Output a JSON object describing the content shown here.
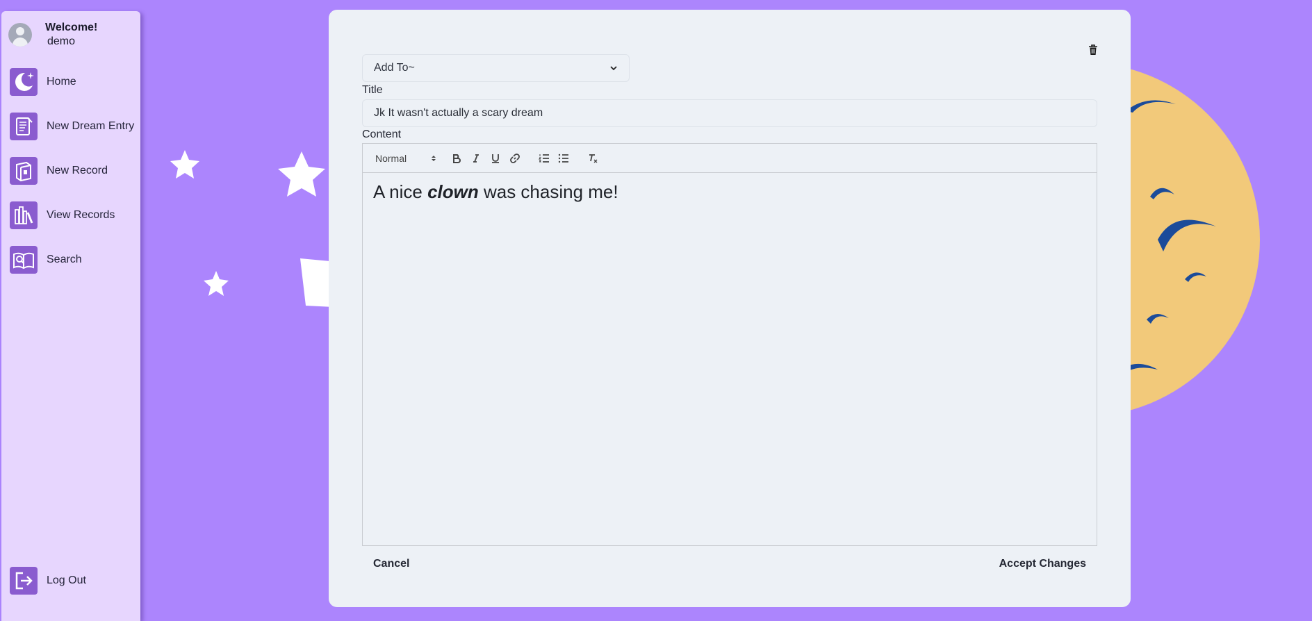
{
  "sidebar": {
    "welcome_title": "Welcome!",
    "username": "demo",
    "items": [
      {
        "label": "Home",
        "icon": "moon-icon"
      },
      {
        "label": "New Dream Entry",
        "icon": "scroll-icon"
      },
      {
        "label": "New Record",
        "icon": "book-icon"
      },
      {
        "label": "View Records",
        "icon": "bookshelf-icon"
      },
      {
        "label": "Search",
        "icon": "open-book-search-icon"
      }
    ],
    "logout_label": "Log Out"
  },
  "editor": {
    "add_to_select": {
      "value": "Add To~"
    },
    "title_label": "Title",
    "title_value": "Jk It wasn't actually a scary dream",
    "content_label": "Content",
    "toolbar": {
      "format_select": "Normal",
      "buttons": [
        "bold",
        "italic",
        "underline",
        "link",
        "ordered-list",
        "bullet-list",
        "clean-format"
      ]
    },
    "content": {
      "before": "A nice ",
      "emphasis": "clown",
      "after": " was chasing me!"
    },
    "cancel_label": "Cancel",
    "accept_label": "Accept Changes"
  },
  "colors": {
    "background": "#ac85fd",
    "sidebar": "#e7d6fe",
    "icon_bg": "#8a5ccf",
    "card": "#edf1f6",
    "moon": "#f2c97a",
    "moon_marks": "#1b4b9a",
    "stars": "#ffffff"
  }
}
